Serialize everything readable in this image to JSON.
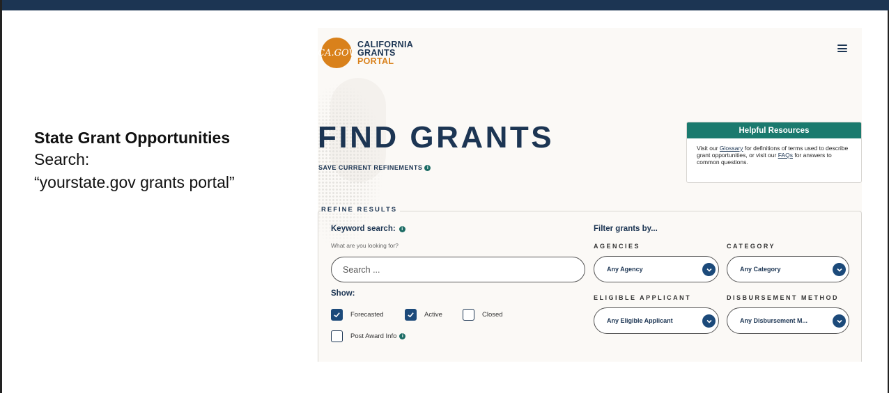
{
  "caption": {
    "title": "State Grant Opportunities",
    "line1": "Search:",
    "line2": "“yourstate.gov grants portal”"
  },
  "site": {
    "logo_seal": "CA.GOV",
    "logo_line1": "CALIFORNIA",
    "logo_line2": "GRANTS",
    "logo_line3": "PORTAL",
    "menu_icon": "hamburger-menu-icon"
  },
  "page": {
    "title": "FIND GRANTS",
    "save_refinements": "SAVE CURRENT REFINEMENTS"
  },
  "resources": {
    "heading": "Helpful Resources",
    "text_1": "Visit our ",
    "link_glossary": "Glossary",
    "text_2": " for definitions of terms used to describe grant opportunities, or visit our ",
    "link_faqs": "FAQs",
    "text_3": " for answers to common questions."
  },
  "refine": {
    "legend": "REFINE RESULTS",
    "keyword_label": "Keyword search:",
    "keyword_hint": "What are you looking for?",
    "search_placeholder": "Search ...",
    "show_label": "Show:",
    "checkboxes": [
      {
        "label": "Forecasted",
        "checked": true
      },
      {
        "label": "Active",
        "checked": true
      },
      {
        "label": "Closed",
        "checked": false
      },
      {
        "label": "Post Award Info",
        "checked": false
      }
    ],
    "filter_label": "Filter grants by...",
    "agencies_caption": "AGENCIES",
    "agencies_value": "Any Agency",
    "category_caption": "CATEGORY",
    "category_value": "Any Category",
    "eligible_caption": "ELIGIBLE APPLICANT",
    "eligible_value": "Any Eligible Applicant",
    "disbursement_caption": "DISBURSEMENT METHOD",
    "disbursement_value": "Any Disbursement M..."
  },
  "colors": {
    "navy": "#1c3553",
    "orange": "#d9811b",
    "teal": "#1a7a6e",
    "check_blue": "#1c4a7a"
  }
}
